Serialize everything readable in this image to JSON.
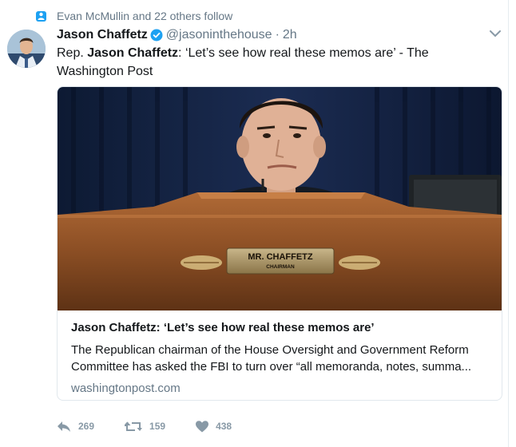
{
  "context": {
    "text": "Evan McMullin and 22 others follow",
    "icon": "person-icon"
  },
  "author": {
    "name": "Jason Chaffetz",
    "handle": "@jasoninthehouse",
    "separator": "·",
    "time": "2h",
    "verified": true
  },
  "tweet": {
    "prefix": "Rep. ",
    "bold": "Jason Chaffetz",
    "suffix": ": ‘Let’s see how real these memos are’ - The Washington Post"
  },
  "card": {
    "title": "Jason Chaffetz: ‘Let’s see how real these memos are’",
    "desc_line1": "The Republican chairman of the House Oversight and Government Reform",
    "desc_line2": "Committee has asked the FBI to turn over “all memoranda, notes, summa...",
    "domain": "washingtonpost.com",
    "nameplate_line1": "MR. CHAFFETZ",
    "nameplate_line2": "CHAIRMAN"
  },
  "actions": {
    "reply": "269",
    "retweet": "159",
    "like": "438"
  },
  "colors": {
    "accent": "#1da1f2",
    "secondary_text": "#657786",
    "action_gray": "#8899a6"
  }
}
